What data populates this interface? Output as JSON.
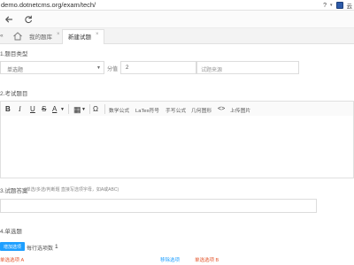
{
  "browser": {
    "url": "demo.dotnetcms.org/exam/tech/",
    "help": "?",
    "dropdown": "▾",
    "ext_icon": "extension-icon",
    "lang_text": "云",
    "nav": {
      "home_icon": "home-icon",
      "back_icon": "arrow-left-icon",
      "refresh_icon": "refresh-icon"
    }
  },
  "tabs": {
    "prefix": "«",
    "items": [
      {
        "label": "我的题库"
      },
      {
        "label": "新建试题"
      }
    ],
    "close": "×"
  },
  "form": {
    "section1": "1.题目类型",
    "type_select": "单选题",
    "score_label": "分值",
    "score_value": "2",
    "source_placeholder": "试题来源",
    "section2": "2.考试题目",
    "toolbar": {
      "bold": "B",
      "italic": "I",
      "underline": "U",
      "strike": "S",
      "font_color": "A",
      "table": "▦",
      "omega": "Ω",
      "math": "数学公式",
      "latex": "LaTex符号",
      "handwrite": "手写公式",
      "geometry": "几何图形",
      "code": "<>",
      "upload": "上传图片"
    },
    "section3": "3.试题答案",
    "hint": "(单选/多选/判断题 直接写选项字母，如A或ABC)",
    "section4": "4.单选题",
    "add_button": "增加选项",
    "count_label": "每行选项数",
    "count_value": "1",
    "options": {
      "a": "单选选项 A",
      "remove": "移除选项",
      "b": "单选选项 B"
    }
  },
  "colors": {
    "accent": "#1e9fff",
    "option_red": "#e4572e",
    "remove_blue": "#1e9fff"
  }
}
